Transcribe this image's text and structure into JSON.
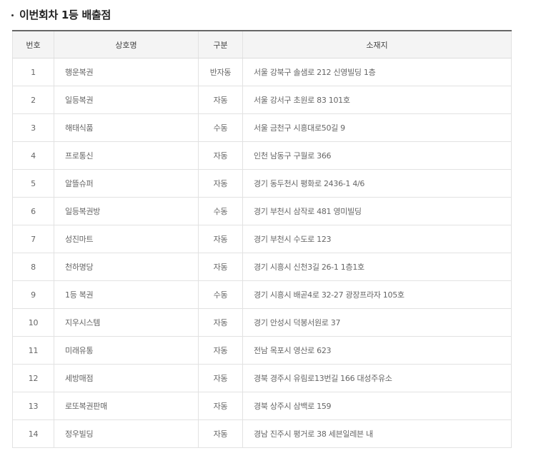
{
  "section": {
    "title": "이번회차 1등 배출점"
  },
  "table": {
    "headers": {
      "no": "번호",
      "name": "상호명",
      "type": "구분",
      "address": "소재지"
    },
    "rows": [
      {
        "no": "1",
        "name": "행운복권",
        "type": "반자동",
        "address": "서울 강북구 솔샘로 212 신영빌딩 1층"
      },
      {
        "no": "2",
        "name": "일등복권",
        "type": "자동",
        "address": "서울 강서구 초원로 83 101호"
      },
      {
        "no": "3",
        "name": "해태식품",
        "type": "수동",
        "address": "서울 금천구 시흥대로50길 9"
      },
      {
        "no": "4",
        "name": "프로통신",
        "type": "자동",
        "address": "인천 남동구 구월로 366"
      },
      {
        "no": "5",
        "name": "알뜰슈퍼",
        "type": "자동",
        "address": "경기 동두천시 평화로 2436-1 4/6"
      },
      {
        "no": "6",
        "name": "일등복권방",
        "type": "수동",
        "address": "경기 부천시 삼작로 481 영미빌딩"
      },
      {
        "no": "7",
        "name": "성진마트",
        "type": "자동",
        "address": "경기 부천시 수도로 123"
      },
      {
        "no": "8",
        "name": "천하명당",
        "type": "자동",
        "address": "경기 시흥시 신천3길 26-1 1층1호"
      },
      {
        "no": "9",
        "name": "1등 복권",
        "type": "수동",
        "address": "경기 시흥시 배곧4로 32-27 광장프라자 105호"
      },
      {
        "no": "10",
        "name": "지우시스템",
        "type": "자동",
        "address": "경기 안성시 덕봉서원로 37"
      },
      {
        "no": "11",
        "name": "미래유통",
        "type": "자동",
        "address": "전남 목포시 영산로 623"
      },
      {
        "no": "12",
        "name": "세방매점",
        "type": "자동",
        "address": "경북 경주시 유림로13번길 166 대성주유소"
      },
      {
        "no": "13",
        "name": "로또복권판매",
        "type": "자동",
        "address": "경북 상주시 삼백로 159"
      },
      {
        "no": "14",
        "name": "정우빌딩",
        "type": "자동",
        "address": "경남 진주시 평거로 38 세븐일레븐 내"
      }
    ]
  }
}
